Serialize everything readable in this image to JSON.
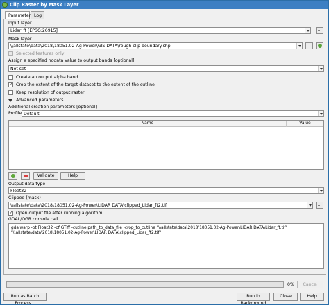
{
  "window": {
    "title": "Clip Raster by Mask Layer"
  },
  "tabs": [
    {
      "label": "Parameters"
    },
    {
      "label": "Log"
    }
  ],
  "input_layer": {
    "label": "Input layer",
    "value": "Lidar_ft [EPSG:26915]"
  },
  "mask_layer": {
    "label": "Mask layer",
    "value": "\\\\allstate\\data\\2018\\18051.02-Ag-Power\\GIS DATA\\rough clip boundary.shp"
  },
  "selected_features_only": {
    "label": "Selected features only"
  },
  "nodata": {
    "label": "Assign a specified nodata value to output bands [optional]",
    "value": "Not set"
  },
  "checkboxes": {
    "alpha_band": "Create an output alpha band",
    "crop_extent": "Crop the extent of the target dataset to the extent of the cutline",
    "keep_resolution": "Keep resolution of output raster"
  },
  "advanced": {
    "label": "Advanced parameters",
    "creation_label": "Additional creation parameters [optional]",
    "profile_label": "Profile",
    "profile_value": "Default",
    "table_headers": [
      "Name",
      "Value"
    ],
    "validate_label": "Validate",
    "help_label": "Help"
  },
  "output_type": {
    "label": "Output data type",
    "value": "Float32"
  },
  "clipped": {
    "label": "Clipped (mask)",
    "value": "\\\\allstate\\data\\2018\\18051.02-Ag-Power\\LIDAR DATA\\clipped_Lidar_ft2.tif"
  },
  "open_output": {
    "label": "Open output file after running algorithm"
  },
  "console": {
    "label": "GDAL/OGR console call",
    "text": "gdalwarp -ot Float32 -of GTiff -cutline path_to_data_file -crop_to_cutline \"\\\\allstate\\data\\2018\\18051.02-Ag-Power\\LIDAR DATA\\Lidar_ft.tif\" \"\\\\allstate\\data\\2018\\18051.02-Ag-Power\\LIDAR DATA\\clipped_Lidar_ft2.tif\""
  },
  "progress": {
    "value": 0,
    "label": "0%"
  },
  "buttons": {
    "cancel": "Cancel",
    "batch": "Run as Batch Process...",
    "run_background": "Run in Background",
    "close": "Close",
    "help": "Help",
    "browse": "..."
  }
}
